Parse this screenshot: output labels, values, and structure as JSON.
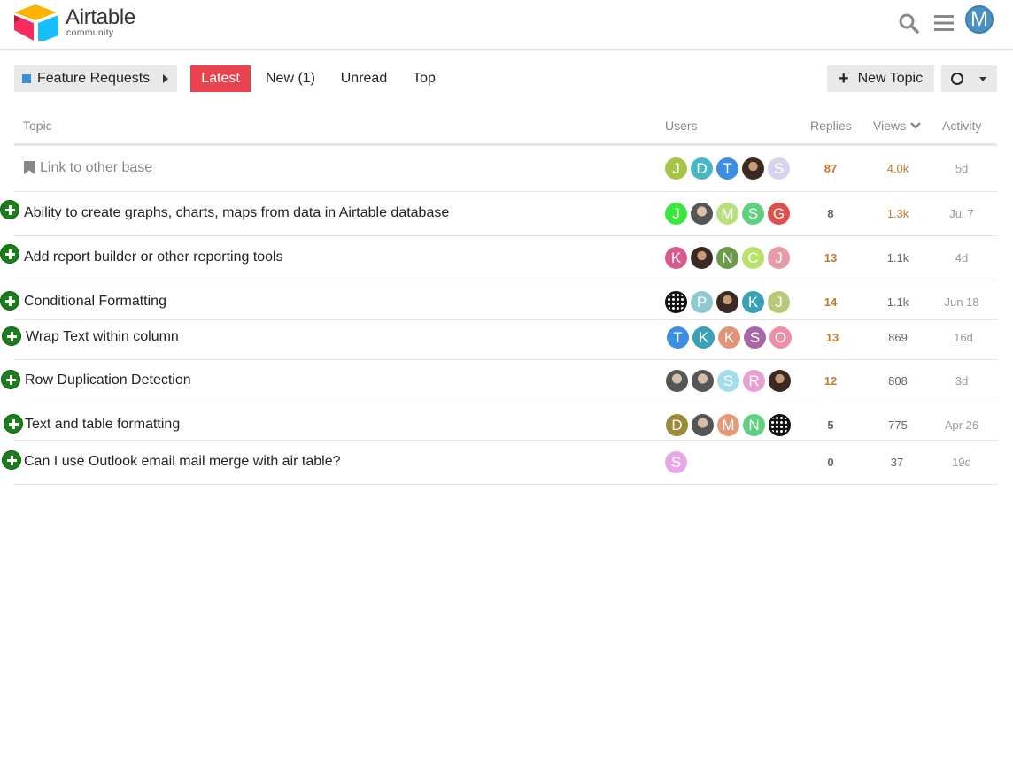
{
  "header": {
    "logo_word": "Airtable",
    "logo_sub": "community",
    "user_initial": "M",
    "user_color": "#4a90c2"
  },
  "nav": {
    "category": "Feature Requests",
    "category_color": "#3b8ed7",
    "tabs": [
      "Latest",
      "New (1)",
      "Unread",
      "Top"
    ],
    "active_tab": "Latest",
    "new_topic": "New Topic"
  },
  "table": {
    "headers": {
      "topic": "Topic",
      "users": "Users",
      "replies": "Replies",
      "views": "Views",
      "activity": "Activity"
    },
    "rows": [
      {
        "title": "Link to other base",
        "pinned": true,
        "replies": "87",
        "views": "4.0k",
        "activity": "5d",
        "hot": true,
        "users": [
          {
            "l": "J",
            "c": "#a8c448"
          },
          {
            "l": "D",
            "c": "#49b6c4"
          },
          {
            "l": "T",
            "c": "#3d8ee0"
          },
          {
            "l": "",
            "c": "photo"
          },
          {
            "l": "S",
            "c": "#d6d3ec"
          }
        ]
      },
      {
        "title": "Ability to create graphs, charts, maps from data in Airtable database",
        "pinned": false,
        "replies": "8",
        "views": "1.3k",
        "activity": "Jul 7",
        "hot": false,
        "users": [
          {
            "l": "J",
            "c": "#3de63d"
          },
          {
            "l": "",
            "c": "photo2"
          },
          {
            "l": "M",
            "c": "#b8e07a"
          },
          {
            "l": "S",
            "c": "#5fd07f"
          },
          {
            "l": "G",
            "c": "#e0504a"
          }
        ]
      },
      {
        "title": "Add report builder or other reporting tools",
        "pinned": false,
        "replies": "13",
        "views": "1.1k",
        "activity": "4d",
        "hot": true,
        "users": [
          {
            "l": "K",
            "c": "#d75b8c"
          },
          {
            "l": "",
            "c": "photo"
          },
          {
            "l": "N",
            "c": "#6a9a48"
          },
          {
            "l": "C",
            "c": "#b9e26a"
          },
          {
            "l": "J",
            "c": "#e99aa8"
          }
        ]
      },
      {
        "title": "Conditional Formatting",
        "pinned": false,
        "replies": "14",
        "views": "1.1k",
        "activity": "Jun 18",
        "hot": true,
        "users": [
          {
            "l": "",
            "c": "pattern"
          },
          {
            "l": "P",
            "c": "#8ec8d0"
          },
          {
            "l": "",
            "c": "photo"
          },
          {
            "l": "K",
            "c": "#3aa0b8"
          },
          {
            "l": "J",
            "c": "#b6c978"
          }
        ]
      },
      {
        "title": "Wrap Text within column",
        "pinned": false,
        "replies": "13",
        "views": "869",
        "activity": "16d",
        "hot": true,
        "users": [
          {
            "l": "T",
            "c": "#3d8ee0"
          },
          {
            "l": "K",
            "c": "#3aa0b8"
          },
          {
            "l": "K",
            "c": "#e29478"
          },
          {
            "l": "S",
            "c": "#a766a8"
          },
          {
            "l": "O",
            "c": "#ee8fa8"
          }
        ]
      },
      {
        "title": "Row Duplication Detection",
        "pinned": false,
        "replies": "12",
        "views": "808",
        "activity": "3d",
        "hot": true,
        "users": [
          {
            "l": "",
            "c": "photo2"
          },
          {
            "l": "",
            "c": "photo2"
          },
          {
            "l": "S",
            "c": "#a5dcec"
          },
          {
            "l": "R",
            "c": "#e6a0d2"
          },
          {
            "l": "",
            "c": "photo"
          }
        ]
      },
      {
        "title": "Text and table formatting",
        "pinned": false,
        "replies": "5",
        "views": "775",
        "activity": "Apr 26",
        "hot": false,
        "users": [
          {
            "l": "D",
            "c": "#9b8a3a"
          },
          {
            "l": "",
            "c": "photo2"
          },
          {
            "l": "M",
            "c": "#e29a78"
          },
          {
            "l": "N",
            "c": "#5fd07f"
          },
          {
            "l": "",
            "c": "pattern"
          }
        ]
      },
      {
        "title": "Can I use Outlook email mail merge with air table?",
        "pinned": false,
        "replies": "0",
        "views": "37",
        "activity": "19d",
        "hot": false,
        "users": [
          {
            "l": "S",
            "c": "#e8a8e8"
          }
        ]
      }
    ]
  }
}
